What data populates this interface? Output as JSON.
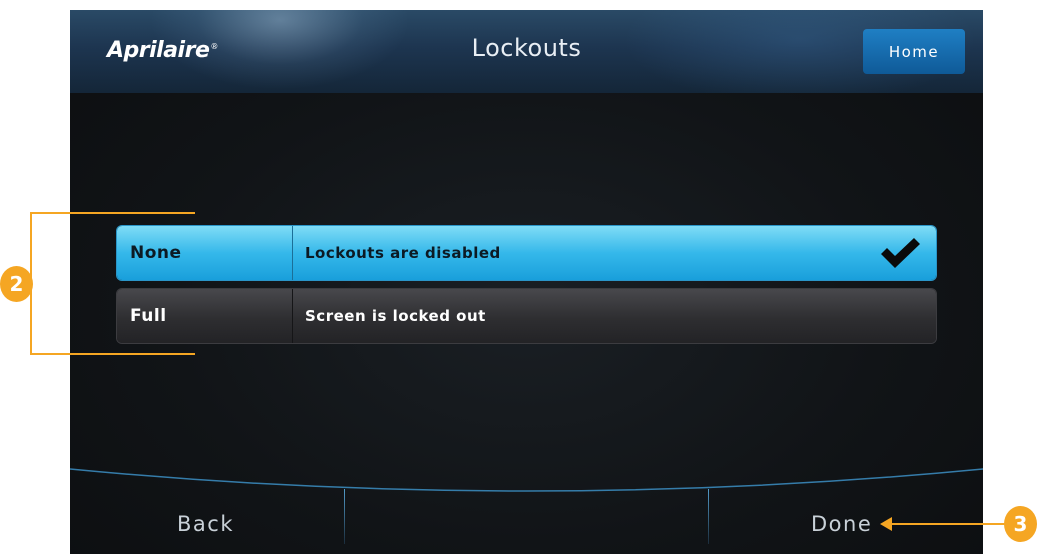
{
  "header": {
    "logo_text": "Aprilaire",
    "logo_mark": "®",
    "title": "Lockouts",
    "home_label": "Home"
  },
  "options": [
    {
      "name": "None",
      "description": "Lockouts are disabled",
      "selected": true
    },
    {
      "name": "Full",
      "description": "Screen is locked out",
      "selected": false
    }
  ],
  "footer": {
    "back_label": "Back",
    "done_label": "Done"
  },
  "annotations": {
    "callout_options": "2",
    "callout_done": "3"
  },
  "icons": {
    "selected_indicator": "checkmark-icon"
  },
  "colors": {
    "accent_orange": "#f5a623",
    "selected_blue": "#35b8ea",
    "home_button_blue": "#1f7fc4"
  }
}
